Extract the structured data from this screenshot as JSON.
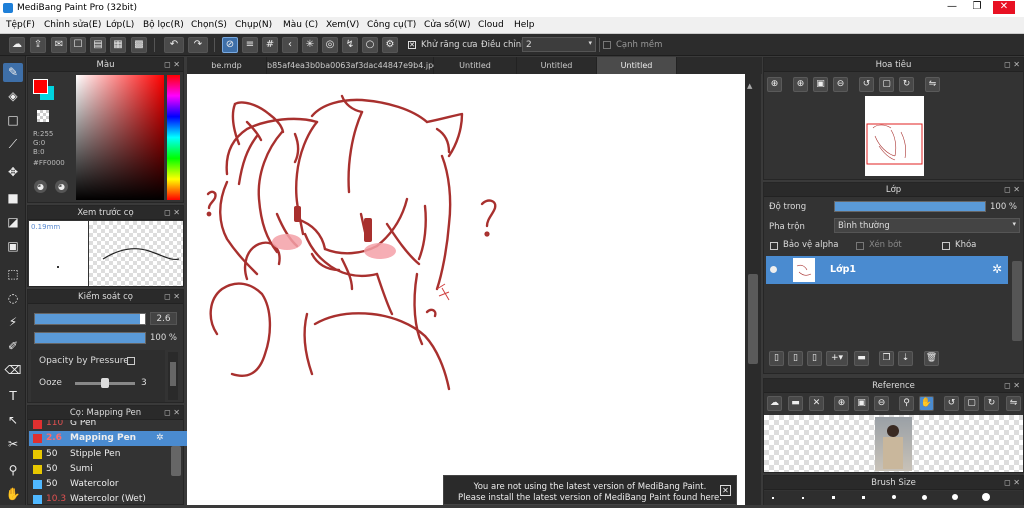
{
  "window": {
    "title": "MediBang Paint Pro (32bit)",
    "controls": [
      "—",
      "❐",
      "✕"
    ]
  },
  "menu": [
    "Tệp(F)",
    "Chỉnh sửa(E)",
    "Lớp(L)",
    "Bộ lọc(R)",
    "Chọn(S)",
    "Chụp(N)",
    "Màu (C)",
    "Xem(V)",
    "Công cụ(T)",
    "Cửa sổ(W)",
    "Cloud",
    "Help"
  ],
  "toolbar": {
    "antialias_label": "Khử răng cưa",
    "correction_label": "Điều chỉnh",
    "correction_value": "2",
    "smooth_label": "Cạnh mềm"
  },
  "color_panel": {
    "title": "Màu",
    "r": "R:255",
    "g": "G:0",
    "b": "B:0",
    "hex": "#FF0000",
    "fg": "#ff0000",
    "bg": "#00d4e0"
  },
  "preview_panel": {
    "title": "Xem trước cọ",
    "size": "0.19mm"
  },
  "brush_control": {
    "title": "Kiểm soát cọ",
    "size_value": "2.6",
    "opacity_value": "100 %",
    "opacity_by_pressure": "Opacity by Pressure",
    "ooze_label": "Ooze",
    "ooze_value": "3",
    "size_fraction": 0.95,
    "ooze_fraction": 0.5
  },
  "brush_list": {
    "title": "Cọ: Mapping Pen",
    "items": [
      {
        "color": "#e03030",
        "size": "110",
        "name": "G Pen"
      },
      {
        "color": "#e03030",
        "size": "2.6",
        "name": "Mapping Pen",
        "active": true
      },
      {
        "color": "#e8c800",
        "size": "50",
        "name": "Stipple Pen"
      },
      {
        "color": "#e8c800",
        "size": "50",
        "name": "Sumi"
      },
      {
        "color": "#4fb8ff",
        "size": "50",
        "name": "Watercolor"
      },
      {
        "color": "#4fb8ff",
        "size": "10.3",
        "name": "Watercolor (Wet)"
      }
    ]
  },
  "tabs": [
    "be.mdp",
    "b85af4ea3b0ba0063af3dac44847e9b4.jpg",
    "Untitled",
    "Untitled",
    "Untitled"
  ],
  "notice": {
    "line1": "You are not using the latest version of MediBang Paint.",
    "line2": "Please install the latest version of MediBang Paint found here."
  },
  "navigator": {
    "title": "Hoa tiêu"
  },
  "layer_panel": {
    "title": "Lớp",
    "opacity_label": "Độ trong",
    "opacity_value": "100 %",
    "opacity_fraction": 1.0,
    "blend_label": "Pha trộn",
    "blend_value": "Bình thường",
    "protect_alpha": "Bảo vệ alpha",
    "clipping": "Xén bớt",
    "lock": "Khóa",
    "layer_name": "Lớp1"
  },
  "reference_panel": {
    "title": "Reference"
  },
  "brushsize_panel": {
    "title": "Brush Size"
  },
  "icons": [
    "pen-icon",
    "eraser-icon",
    "select-rect-icon",
    "move-icon",
    "fill-icon",
    "text-icon",
    "hand-icon",
    "gear-icon",
    "zoom-in-icon",
    "zoom-out-icon",
    "rotate-icon",
    "undo-icon",
    "redo-icon",
    "close-icon",
    "new-layer-icon",
    "trash-icon"
  ]
}
